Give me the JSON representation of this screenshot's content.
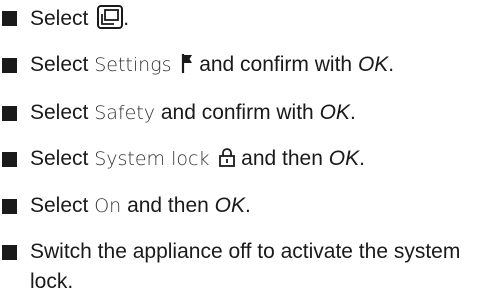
{
  "steps": [
    {
      "pre": "Select",
      "after_icon": ".",
      "icon": "menu-icon"
    },
    {
      "pre": "Select",
      "ui": "Settings",
      "icon": "flag-icon",
      "mid": "and confirm with",
      "em": "OK",
      "post": "."
    },
    {
      "pre": "Select",
      "ui": "Safety",
      "mid": "and confirm with",
      "em": "OK",
      "post": "."
    },
    {
      "pre": "Select",
      "ui": "System lock",
      "icon": "lock-icon",
      "mid": "and then",
      "em": "OK",
      "post": "."
    },
    {
      "pre": "Select",
      "ui": "On",
      "mid": "and then",
      "em": "OK",
      "post": "."
    },
    {
      "text": "Switch the appliance off to activate the system lock."
    }
  ],
  "colors": {
    "text": "#1a1a1a",
    "ui_text": "#333333"
  }
}
